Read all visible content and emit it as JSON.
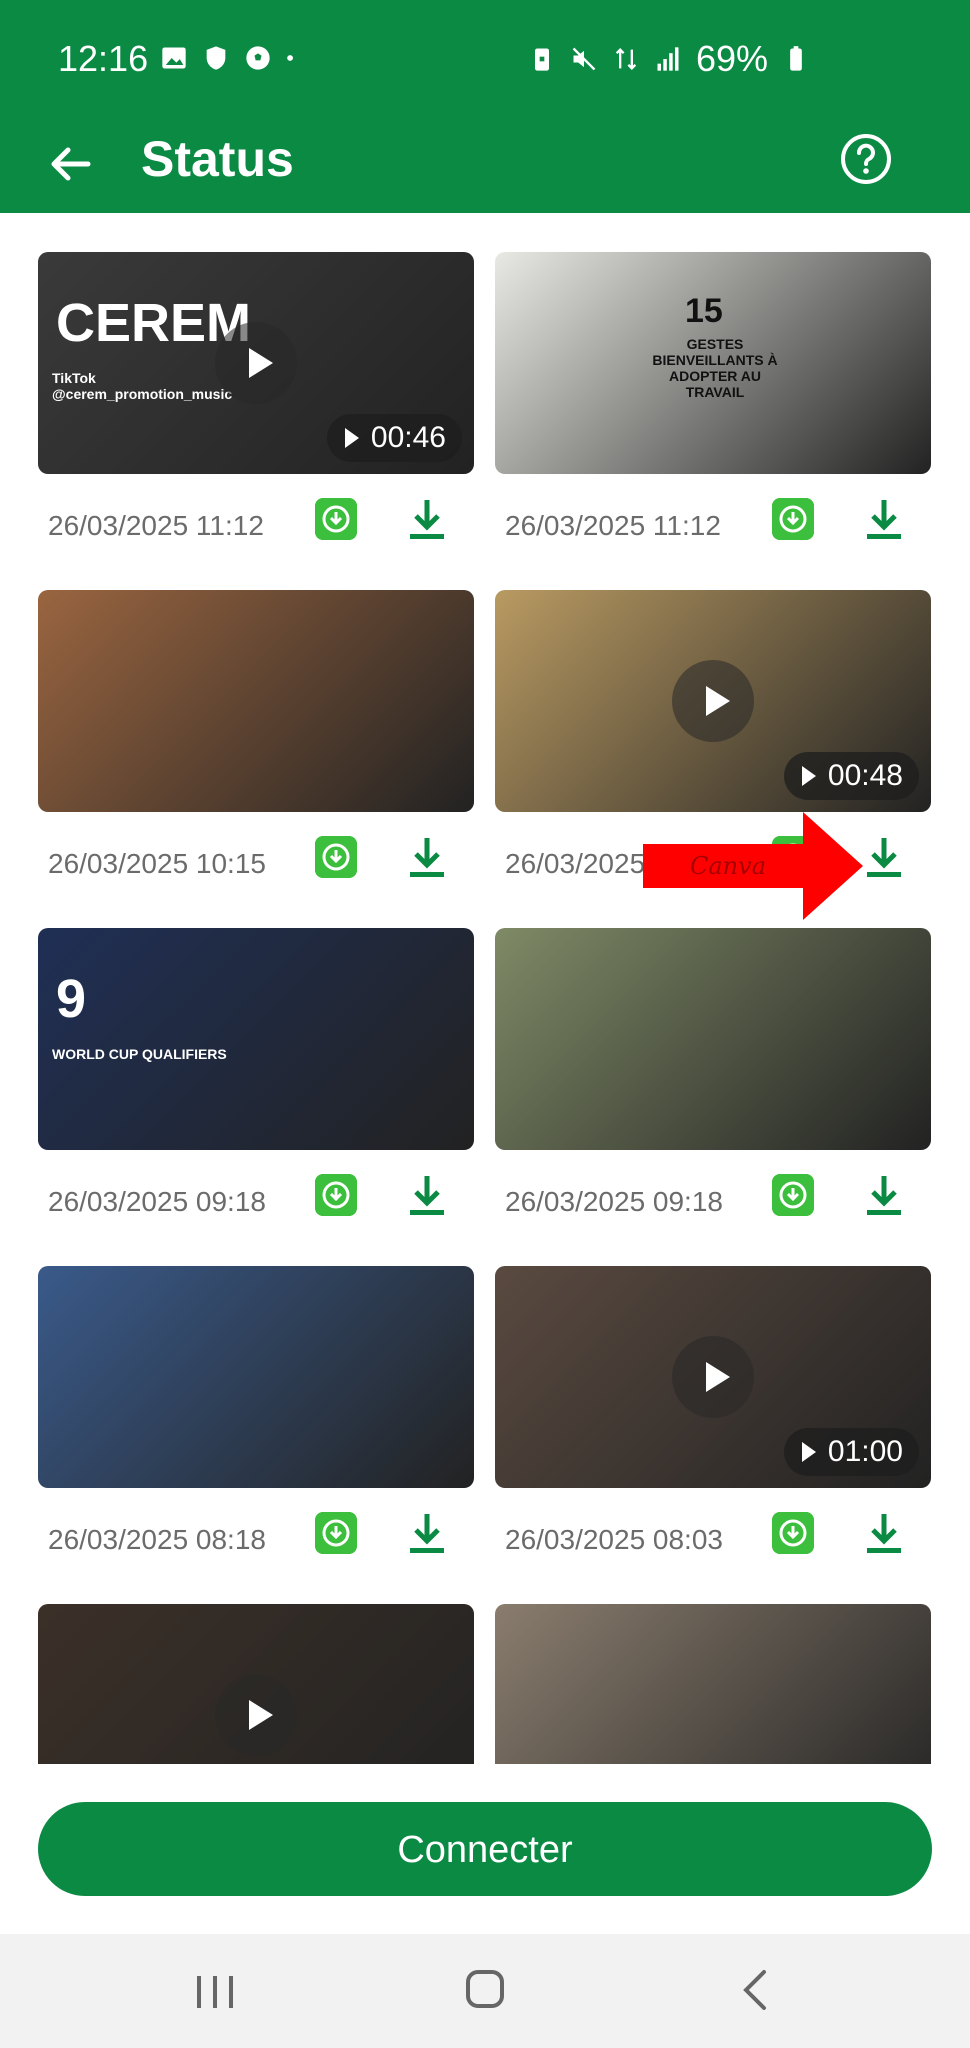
{
  "status_bar": {
    "time": "12:16",
    "battery": "69%",
    "left_icons": [
      "image-icon",
      "shield-icon",
      "soccer-ball-icon",
      "dot-icon"
    ],
    "right_icons": [
      "battery-saver-icon",
      "mute-icon",
      "data-icon",
      "signal-icon",
      "battery-icon"
    ]
  },
  "app_bar": {
    "title": "Status",
    "back_icon": "arrow-left-icon",
    "help_icon": "help-circle-icon"
  },
  "items": [
    {
      "date": "26/03/2025 11:12",
      "type": "video",
      "duration": "00:46",
      "thumb_color": "#3a3a3a",
      "caption_main": "CEREM",
      "caption_small": "TikTok @cerem_promotion_music"
    },
    {
      "date": "26/03/2025 11:12",
      "type": "image",
      "thumb_color": "#e9e9e4",
      "caption_main": "15",
      "caption_small": "GESTES BIENVEILLANTS À ADOPTER AU TRAVAIL"
    },
    {
      "date": "26/03/2025 10:15",
      "type": "image",
      "thumb_color": "#9a6540"
    },
    {
      "date": "26/03/2025",
      "type": "video",
      "duration": "00:48",
      "thumb_color": "#b99a62"
    },
    {
      "date": "26/03/2025 09:18",
      "type": "image",
      "thumb_color": "#1f2f55",
      "caption_main": "9",
      "caption_small": "WORLD CUP QUALIFIERS"
    },
    {
      "date": "26/03/2025 09:18",
      "type": "image",
      "thumb_color": "#7f8a66"
    },
    {
      "date": "26/03/2025 08:18",
      "type": "image",
      "thumb_color": "#3a5a8a"
    },
    {
      "date": "26/03/2025 08:03",
      "type": "video",
      "duration": "01:00",
      "thumb_color": "#5a4a40"
    },
    {
      "date": "",
      "type": "video",
      "thumb_color": "#3b3028"
    },
    {
      "date": "",
      "type": "image",
      "thumb_color": "#8a7d6e"
    }
  ],
  "overlay": {
    "arrow_text": "Canva",
    "arrow_color": "#ff0000"
  },
  "connect_button": "Connecter",
  "nav": {
    "recent_icon": "recent-apps-icon",
    "home_icon": "home-icon",
    "back_icon": "nav-back-icon"
  },
  "colors": {
    "primary": "#0b8a44",
    "whatsapp": "#3cbf3c",
    "date_text": "#6b6b6b"
  }
}
